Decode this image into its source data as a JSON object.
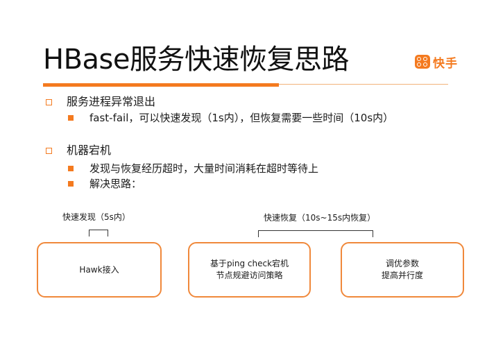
{
  "slide": {
    "title": "HBase服务快速恢复思路",
    "brand": {
      "name": "快手",
      "color": "#f47a1f"
    }
  },
  "bullets": [
    {
      "text": "服务进程异常退出",
      "sub": [
        "fast-fail，可以快速发现（1s内），但恢复需要一些时间（10s内）"
      ]
    },
    {
      "text": "机器宕机",
      "sub": [
        "发现与恢复经历超时，大量时间消耗在超时等待上",
        "解决思路："
      ]
    }
  ],
  "diagram": {
    "detect_label": "快速发现（5s内）",
    "recover_label": "快速恢复（10s~15s内恢复）",
    "boxes": [
      {
        "lines": [
          "Hawk接入"
        ]
      },
      {
        "lines": [
          "基于ping check宕机",
          "节点规避访问策略"
        ]
      },
      {
        "lines": [
          "调优参数",
          "提高并行度"
        ]
      }
    ]
  },
  "colors": {
    "accent": "#f47a1f",
    "box_border": "#f0883a"
  }
}
